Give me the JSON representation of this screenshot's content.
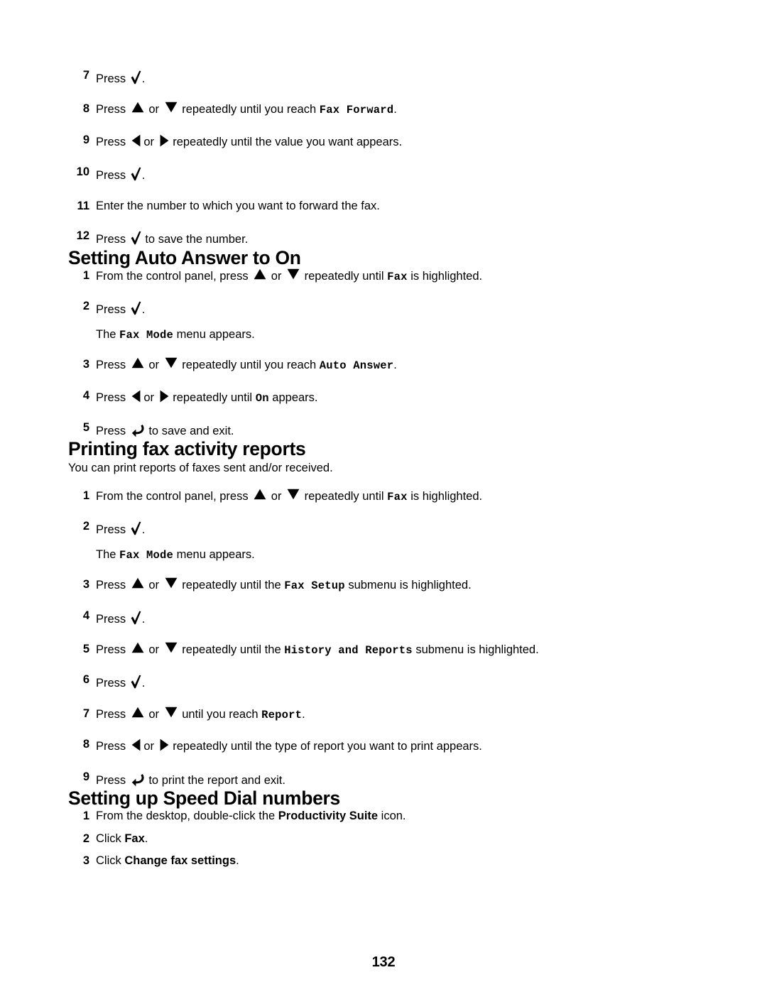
{
  "document": {
    "page_number": "132",
    "text_color": "#000000",
    "background_color": "#ffffff"
  },
  "icons": {
    "check": "check-icon",
    "up": "up-arrow-icon",
    "down": "down-arrow-icon",
    "left": "left-arrow-icon",
    "right": "right-arrow-icon",
    "back": "back-arrow-icon"
  },
  "continued_steps": {
    "items": [
      {
        "num": "7",
        "parts": [
          {
            "t": "text",
            "v": "Press "
          },
          {
            "t": "icon",
            "v": "check"
          },
          {
            "t": "text",
            "v": "."
          }
        ]
      },
      {
        "num": "8",
        "parts": [
          {
            "t": "text",
            "v": "Press "
          },
          {
            "t": "icon",
            "v": "up"
          },
          {
            "t": "text",
            "v": " or "
          },
          {
            "t": "icon",
            "v": "down"
          },
          {
            "t": "text",
            "v": " repeatedly until you reach "
          },
          {
            "t": "code",
            "v": "Fax Forward"
          },
          {
            "t": "text",
            "v": "."
          }
        ]
      },
      {
        "num": "9",
        "parts": [
          {
            "t": "text",
            "v": "Press "
          },
          {
            "t": "icon",
            "v": "left"
          },
          {
            "t": "text",
            "v": " or "
          },
          {
            "t": "icon",
            "v": "right"
          },
          {
            "t": "text",
            "v": " repeatedly until the value you want appears."
          }
        ]
      },
      {
        "num": "10",
        "parts": [
          {
            "t": "text",
            "v": "Press "
          },
          {
            "t": "icon",
            "v": "check"
          },
          {
            "t": "text",
            "v": "."
          }
        ]
      },
      {
        "num": "11",
        "parts": [
          {
            "t": "text",
            "v": "Enter the number to which you want to forward the fax."
          }
        ]
      },
      {
        "num": "12",
        "parts": [
          {
            "t": "text",
            "v": "Press "
          },
          {
            "t": "icon",
            "v": "check"
          },
          {
            "t": "text",
            "v": " to save the number."
          }
        ]
      }
    ]
  },
  "section_auto_answer": {
    "heading": "Setting Auto Answer to On",
    "items": [
      {
        "num": "1",
        "parts": [
          {
            "t": "text",
            "v": "From the control panel, press "
          },
          {
            "t": "icon",
            "v": "up"
          },
          {
            "t": "text",
            "v": " or "
          },
          {
            "t": "icon",
            "v": "down"
          },
          {
            "t": "text",
            "v": " repeatedly until "
          },
          {
            "t": "code",
            "v": "Fax"
          },
          {
            "t": "text",
            "v": " is highlighted."
          }
        ]
      },
      {
        "num": "2",
        "parts": [
          {
            "t": "text",
            "v": "Press "
          },
          {
            "t": "icon",
            "v": "check"
          },
          {
            "t": "text",
            "v": "."
          }
        ],
        "subline": [
          {
            "t": "text",
            "v": "The "
          },
          {
            "t": "code",
            "v": "Fax Mode"
          },
          {
            "t": "text",
            "v": " menu appears."
          }
        ]
      },
      {
        "num": "3",
        "parts": [
          {
            "t": "text",
            "v": "Press "
          },
          {
            "t": "icon",
            "v": "up"
          },
          {
            "t": "text",
            "v": " or "
          },
          {
            "t": "icon",
            "v": "down"
          },
          {
            "t": "text",
            "v": " repeatedly until you reach "
          },
          {
            "t": "code",
            "v": "Auto Answer"
          },
          {
            "t": "text",
            "v": "."
          }
        ]
      },
      {
        "num": "4",
        "parts": [
          {
            "t": "text",
            "v": "Press "
          },
          {
            "t": "icon",
            "v": "left"
          },
          {
            "t": "text",
            "v": " or "
          },
          {
            "t": "icon",
            "v": "right"
          },
          {
            "t": "text",
            "v": " repeatedly until "
          },
          {
            "t": "code",
            "v": "On"
          },
          {
            "t": "text",
            "v": " appears."
          }
        ]
      },
      {
        "num": "5",
        "parts": [
          {
            "t": "text",
            "v": "Press "
          },
          {
            "t": "icon",
            "v": "back"
          },
          {
            "t": "text",
            "v": " to save and exit."
          }
        ]
      }
    ]
  },
  "section_reports": {
    "heading": "Printing fax activity reports",
    "intro": "You can print reports of faxes sent and/or received.",
    "items": [
      {
        "num": "1",
        "parts": [
          {
            "t": "text",
            "v": "From the control panel, press "
          },
          {
            "t": "icon",
            "v": "up"
          },
          {
            "t": "text",
            "v": " or "
          },
          {
            "t": "icon",
            "v": "down"
          },
          {
            "t": "text",
            "v": " repeatedly until "
          },
          {
            "t": "code",
            "v": "Fax"
          },
          {
            "t": "text",
            "v": " is highlighted."
          }
        ]
      },
      {
        "num": "2",
        "parts": [
          {
            "t": "text",
            "v": "Press "
          },
          {
            "t": "icon",
            "v": "check"
          },
          {
            "t": "text",
            "v": "."
          }
        ],
        "subline": [
          {
            "t": "text",
            "v": "The "
          },
          {
            "t": "code",
            "v": "Fax Mode"
          },
          {
            "t": "text",
            "v": " menu appears."
          }
        ]
      },
      {
        "num": "3",
        "parts": [
          {
            "t": "text",
            "v": "Press "
          },
          {
            "t": "icon",
            "v": "up"
          },
          {
            "t": "text",
            "v": " or "
          },
          {
            "t": "icon",
            "v": "down"
          },
          {
            "t": "text",
            "v": " repeatedly until the "
          },
          {
            "t": "code",
            "v": "Fax Setup"
          },
          {
            "t": "text",
            "v": " submenu is highlighted."
          }
        ]
      },
      {
        "num": "4",
        "parts": [
          {
            "t": "text",
            "v": "Press "
          },
          {
            "t": "icon",
            "v": "check"
          },
          {
            "t": "text",
            "v": "."
          }
        ]
      },
      {
        "num": "5",
        "parts": [
          {
            "t": "text",
            "v": "Press "
          },
          {
            "t": "icon",
            "v": "up"
          },
          {
            "t": "text",
            "v": " or "
          },
          {
            "t": "icon",
            "v": "down"
          },
          {
            "t": "text",
            "v": " repeatedly until the "
          },
          {
            "t": "code",
            "v": "History and Reports"
          },
          {
            "t": "text",
            "v": " submenu is highlighted."
          }
        ]
      },
      {
        "num": "6",
        "parts": [
          {
            "t": "text",
            "v": "Press "
          },
          {
            "t": "icon",
            "v": "check"
          },
          {
            "t": "text",
            "v": "."
          }
        ]
      },
      {
        "num": "7",
        "parts": [
          {
            "t": "text",
            "v": "Press "
          },
          {
            "t": "icon",
            "v": "up"
          },
          {
            "t": "text",
            "v": " or "
          },
          {
            "t": "icon",
            "v": "down"
          },
          {
            "t": "text",
            "v": " until you reach "
          },
          {
            "t": "code",
            "v": "Report"
          },
          {
            "t": "text",
            "v": "."
          }
        ]
      },
      {
        "num": "8",
        "parts": [
          {
            "t": "text",
            "v": "Press "
          },
          {
            "t": "icon",
            "v": "left"
          },
          {
            "t": "text",
            "v": " or "
          },
          {
            "t": "icon",
            "v": "right"
          },
          {
            "t": "text",
            "v": " repeatedly until the type of report you want to print appears."
          }
        ]
      },
      {
        "num": "9",
        "parts": [
          {
            "t": "text",
            "v": "Press "
          },
          {
            "t": "icon",
            "v": "back"
          },
          {
            "t": "text",
            "v": " to print the report and exit."
          }
        ]
      }
    ]
  },
  "section_speed_dial": {
    "heading": "Setting up Speed Dial numbers",
    "items": [
      {
        "num": "1",
        "parts": [
          {
            "t": "text",
            "v": "From the desktop, double-click the "
          },
          {
            "t": "ui",
            "v": "Productivity Suite"
          },
          {
            "t": "text",
            "v": " icon."
          }
        ]
      },
      {
        "num": "2",
        "parts": [
          {
            "t": "text",
            "v": "Click "
          },
          {
            "t": "ui",
            "v": "Fax"
          },
          {
            "t": "text",
            "v": "."
          }
        ]
      },
      {
        "num": "3",
        "parts": [
          {
            "t": "text",
            "v": "Click "
          },
          {
            "t": "ui",
            "v": "Change fax settings"
          },
          {
            "t": "text",
            "v": "."
          }
        ]
      }
    ]
  }
}
